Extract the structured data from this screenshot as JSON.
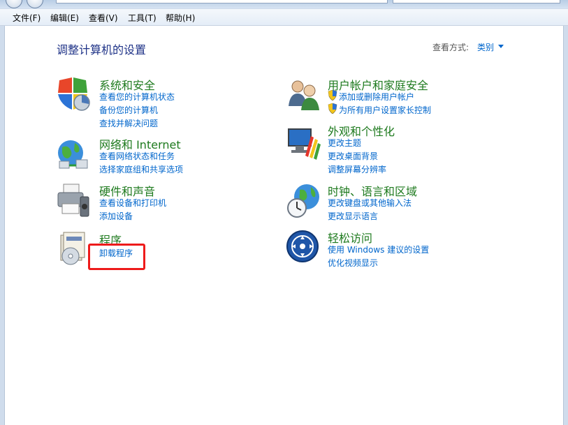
{
  "menubar": {
    "items": [
      "文件(F)",
      "编辑(E)",
      "查看(V)",
      "工具(T)",
      "帮助(H)"
    ]
  },
  "header": {
    "title": "调整计算机的设置",
    "view_by_label": "查看方式:",
    "view_by_value": "类别"
  },
  "categories": {
    "security": {
      "title": "系统和安全",
      "links": [
        "查看您的计算机状态",
        "备份您的计算机",
        "查找并解决问题"
      ]
    },
    "network": {
      "title": "网络和 Internet",
      "links": [
        "查看网络状态和任务",
        "选择家庭组和共享选项"
      ]
    },
    "hardware": {
      "title": "硬件和声音",
      "links": [
        "查看设备和打印机",
        "添加设备"
      ]
    },
    "programs": {
      "title": "程序",
      "links": [
        "卸载程序"
      ]
    },
    "users": {
      "title": "用户帐户和家庭安全",
      "links": [
        "添加或删除用户帐户",
        "为所有用户设置家长控制"
      ]
    },
    "appearance": {
      "title": "外观和个性化",
      "links": [
        "更改主题",
        "更改桌面背景",
        "调整屏幕分辨率"
      ]
    },
    "clock": {
      "title": "时钟、语言和区域",
      "links": [
        "更改键盘或其他输入法",
        "更改显示语言"
      ]
    },
    "ease": {
      "title": "轻松访问",
      "links": [
        "使用 Windows 建议的设置",
        "优化视频显示"
      ]
    }
  },
  "colors": {
    "link": "#0066cc",
    "category_title": "#1e7a1e",
    "page_title": "#1e3287",
    "highlight": "#ee1b1b"
  }
}
